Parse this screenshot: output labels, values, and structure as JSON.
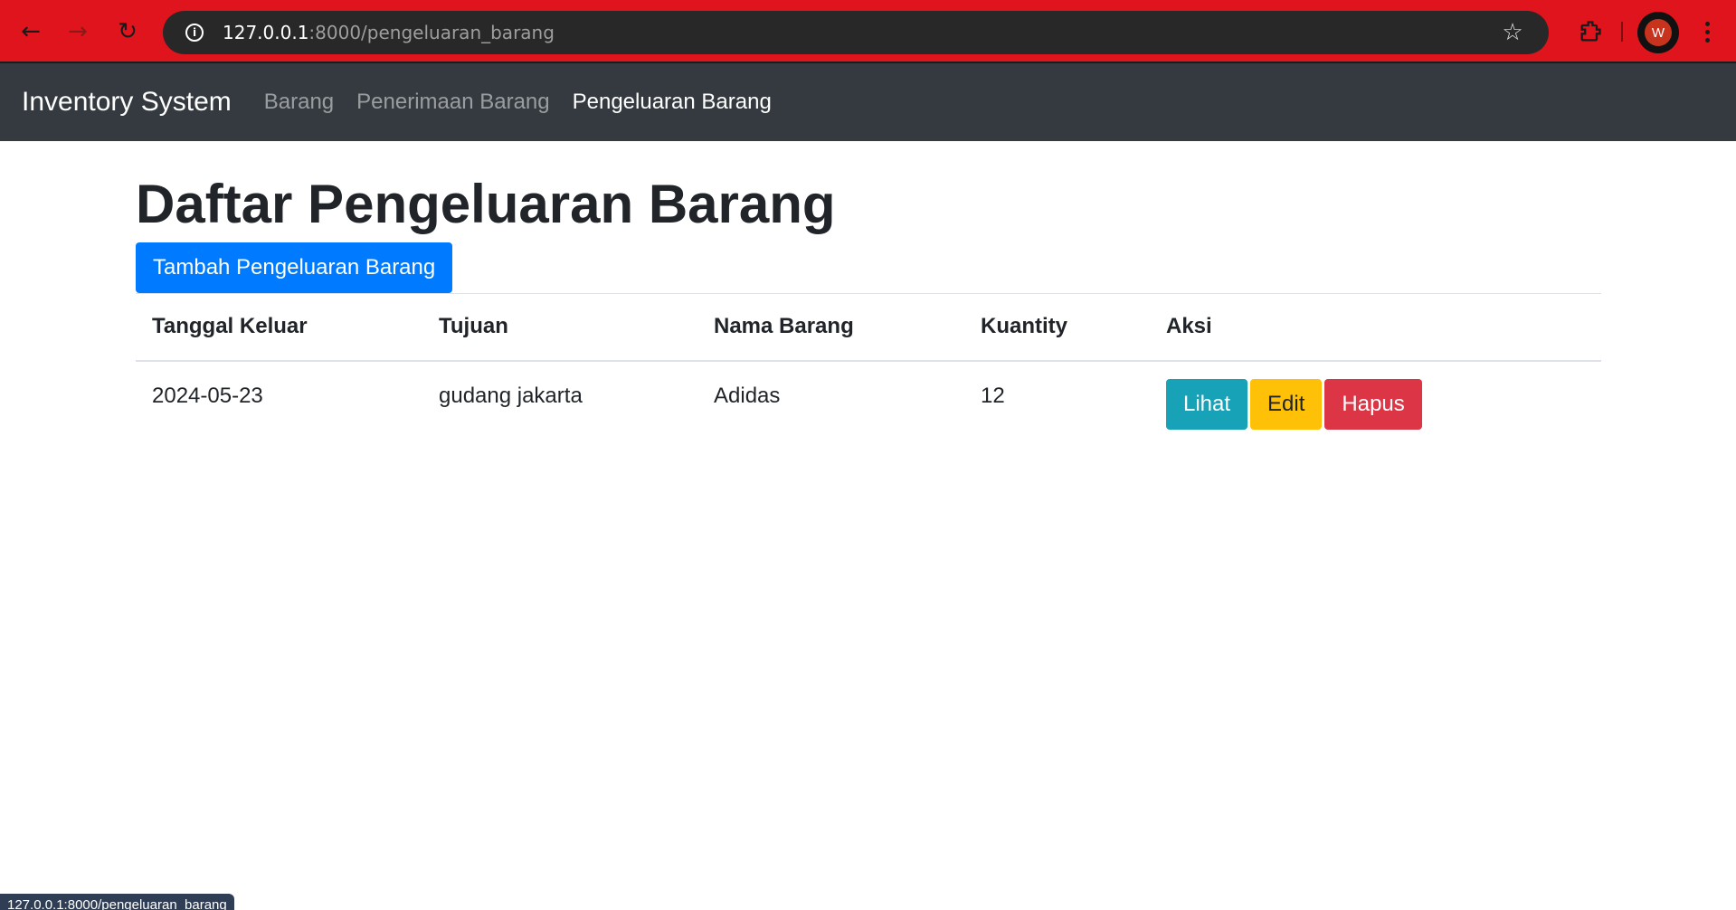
{
  "browser": {
    "url_host": "127.0.0.1",
    "url_path": ":8000/pengeluaran_barang",
    "profile_initial": "W",
    "status_url": "127.0.0.1:8000/pengeluaran_barang",
    "colors": {
      "frame": "#e0141c",
      "omnibox": "#282828"
    }
  },
  "navbar": {
    "brand": "Inventory System",
    "links": [
      {
        "label": "Barang",
        "active": false
      },
      {
        "label": "Penerimaan Barang",
        "active": false
      },
      {
        "label": "Pengeluaran Barang",
        "active": true
      }
    ],
    "colors": {
      "background": "#343a40"
    }
  },
  "main": {
    "title": "Daftar Pengeluaran Barang",
    "add_button": "Tambah Pengeluaran Barang",
    "table": {
      "headers": [
        "Tanggal Keluar",
        "Tujuan",
        "Nama Barang",
        "Kuantity",
        "Aksi"
      ],
      "rows": [
        {
          "tanggal_keluar": "2024-05-23",
          "tujuan": "gudang jakarta",
          "nama_barang": "Adidas",
          "kuantity": "12",
          "actions": {
            "view": "Lihat",
            "edit": "Edit",
            "delete": "Hapus"
          }
        }
      ]
    },
    "colors": {
      "primary": "#007bff",
      "info": "#17a2b8",
      "warning": "#ffc107",
      "danger": "#dc3545"
    }
  }
}
